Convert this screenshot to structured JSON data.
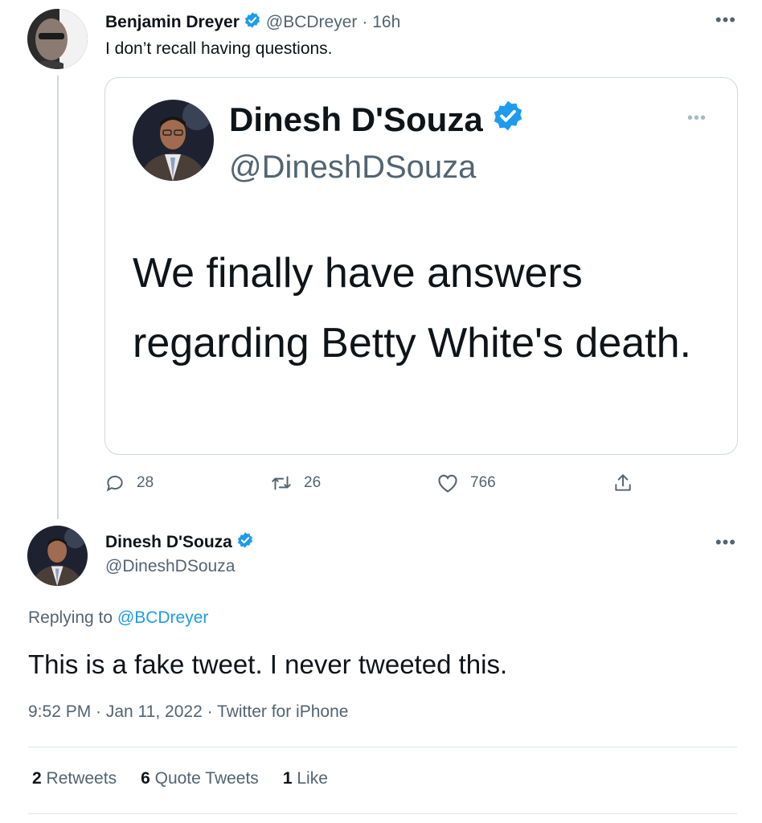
{
  "tweet": {
    "author_name": "Benjamin Dreyer",
    "author_handle": "@BCDreyer",
    "time": "· 16h",
    "text": "I don’t recall having questions.",
    "more": "•••"
  },
  "quoted": {
    "author_name": "Dinesh D'Souza",
    "author_handle": "@DineshDSouza",
    "text": "We finally have answers regarding Betty White's death.",
    "more": "•••"
  },
  "actions": {
    "replies": "28",
    "retweets": "26",
    "likes": "766"
  },
  "reply": {
    "author_name": "Dinesh D'Souza",
    "author_handle": "@DineshDSouza",
    "more": "•••",
    "replying_prefix": "Replying to",
    "replying_to": "@BCDreyer",
    "text": "This is a fake tweet. I never tweeted this.",
    "meta": "9:52 PM · Jan 11, 2022 · Twitter for iPhone",
    "stats": {
      "retweets_count": "2",
      "retweets_label": "Retweets",
      "quote_count": "6",
      "quote_label": "Quote Tweets",
      "likes_count": "1",
      "likes_label": "Like"
    }
  },
  "colors": {
    "verified_blue": "#1d9bf0",
    "text": "#0f1419",
    "secondary": "#536471",
    "border": "#cfd9de"
  }
}
